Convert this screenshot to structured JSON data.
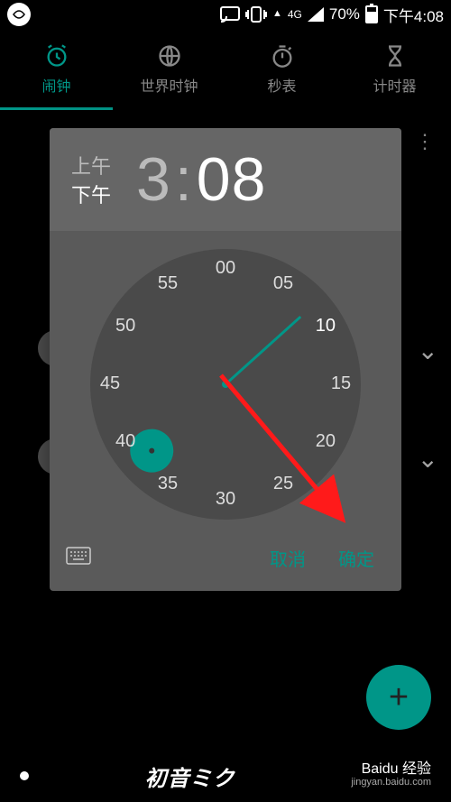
{
  "status": {
    "network_label": "4G",
    "battery_pct": "70%",
    "clock": "下午4:08"
  },
  "tabs": {
    "alarm": "闹钟",
    "world": "世界时钟",
    "stopwatch": "秒表",
    "timer": "计时器"
  },
  "picker": {
    "am_label": "上午",
    "pm_label": "下午",
    "hour": "3",
    "colon": ":",
    "minute": "08",
    "ticks": [
      "00",
      "05",
      "10",
      "15",
      "20",
      "25",
      "30",
      "35",
      "40",
      "45",
      "50",
      "55"
    ],
    "cancel": "取消",
    "ok": "确定"
  },
  "fab": {
    "plus": "+"
  },
  "bottom": {
    "brand": "初音ミク",
    "right1": "Baidu 经验",
    "right2": "jingyan.baidu.com"
  }
}
